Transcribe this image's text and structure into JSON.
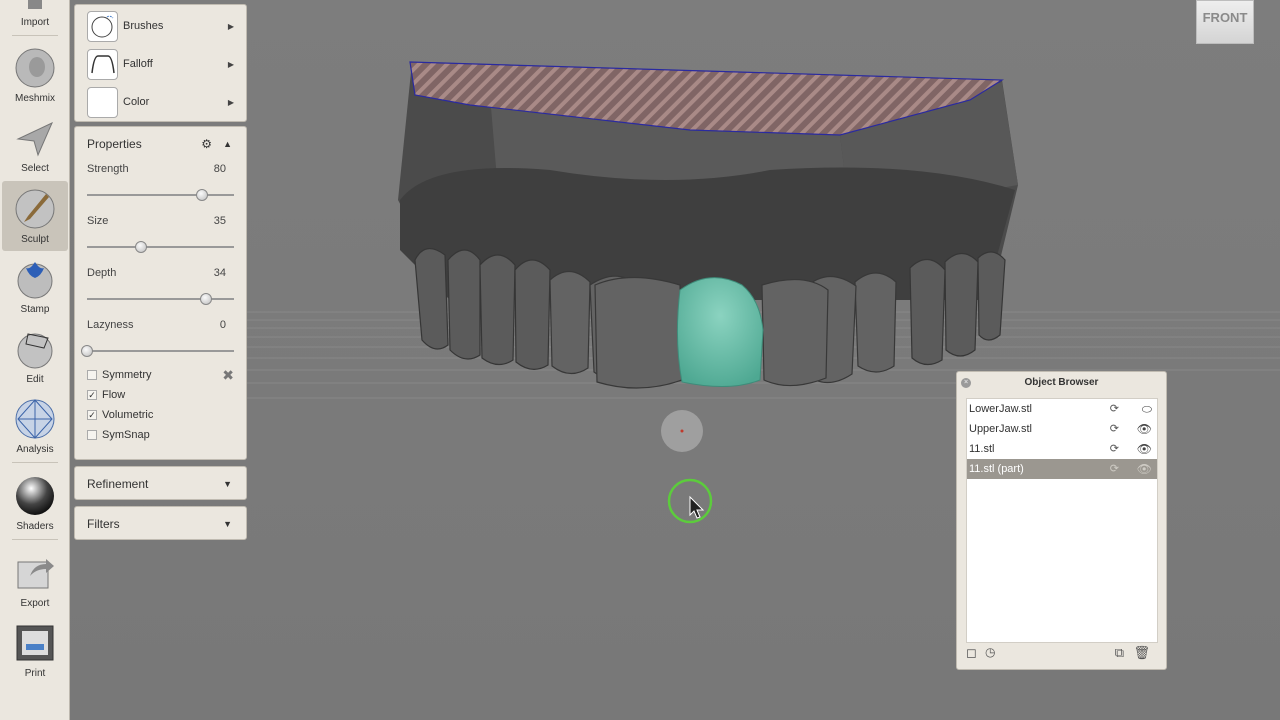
{
  "toolbar": {
    "items": [
      {
        "label": "Import"
      },
      {
        "label": "Meshmix"
      },
      {
        "label": "Select"
      },
      {
        "label": "Sculpt"
      },
      {
        "label": "Stamp"
      },
      {
        "label": "Edit"
      },
      {
        "label": "Analysis"
      },
      {
        "label": "Shaders"
      },
      {
        "label": "Export"
      },
      {
        "label": "Print"
      }
    ],
    "active": "Sculpt"
  },
  "brush_panel": {
    "brushes_label": "Brushes",
    "falloff_label": "Falloff",
    "color_label": "Color"
  },
  "properties": {
    "title": "Properties",
    "sliders": [
      {
        "label": "Strength",
        "value": "80",
        "level": 0.78
      },
      {
        "label": "Size",
        "value": "35",
        "level": 0.37
      },
      {
        "label": "Depth",
        "value": "34",
        "level": 0.81
      },
      {
        "label": "Lazyness",
        "value": "0",
        "level": 0.0
      }
    ],
    "checks": [
      {
        "label": "Symmetry",
        "checked": false
      },
      {
        "label": "Flow",
        "checked": true
      },
      {
        "label": "Volumetric",
        "checked": true
      },
      {
        "label": "SymSnap",
        "checked": false
      }
    ]
  },
  "refinement": {
    "title": "Refinement"
  },
  "filters": {
    "title": "Filters"
  },
  "object_browser": {
    "title": "Object Browser",
    "items": [
      {
        "label": "LowerJaw.stl",
        "selected": false,
        "visible": false
      },
      {
        "label": "UpperJaw.stl",
        "selected": false,
        "visible": true
      },
      {
        "label": "11.stl",
        "selected": false,
        "visible": true
      },
      {
        "label": "11.stl (part)",
        "selected": true,
        "visible": true
      }
    ]
  },
  "viewcube": {
    "label": "FRONT"
  },
  "colors": {
    "viewport_bg": "#7b7b7b",
    "model": "#4a4a4a",
    "tooth_highlight": "#6fc2ae",
    "cut_surface": "#8a6a6a",
    "cursor_ring": "#5ccc3c",
    "outline": "#2a2aa0"
  }
}
